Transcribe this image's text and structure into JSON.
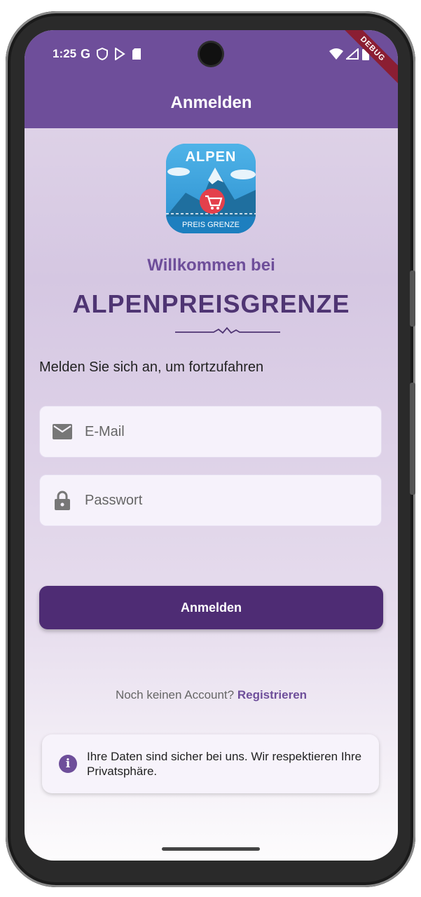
{
  "status_bar": {
    "time": "1:25",
    "icons": [
      "google-icon",
      "shield-icon",
      "play-store-icon",
      "sd-card-icon"
    ],
    "right_icons": [
      "wifi-icon",
      "cellular-icon",
      "battery-icon"
    ],
    "debug_banner": "DEBUG"
  },
  "app_bar": {
    "title": "Anmelden"
  },
  "logo": {
    "line1": "ALPEN",
    "line2": "PREIS GRENZE"
  },
  "welcome": {
    "heading": "Willkommen bei",
    "brand": "ALPENPREISGRENZE"
  },
  "form": {
    "prompt": "Melden Sie sich an, um fortzufahren",
    "email_placeholder": "E-Mail",
    "password_placeholder": "Passwort",
    "submit_label": "Anmelden"
  },
  "register": {
    "question": "Noch keinen Account?",
    "link": "Registrieren"
  },
  "info": {
    "text": "Ihre Daten sind sicher bei uns. Wir respektieren Ihre Privatsphäre."
  },
  "colors": {
    "primary": "#6e4e9a",
    "button": "#4e2c74",
    "debug": "#8b1e33"
  }
}
